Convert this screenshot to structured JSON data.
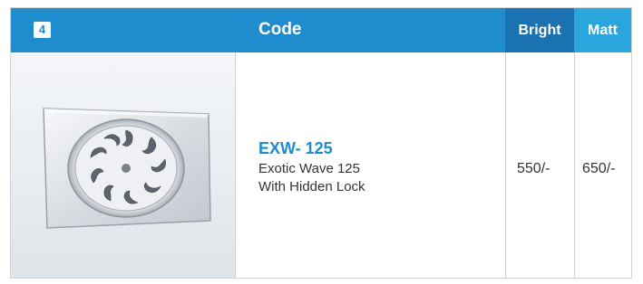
{
  "header": {
    "number": "4",
    "code": "Code",
    "bright": "Bright",
    "matt": "Matt"
  },
  "product": {
    "code": "EXW- 125",
    "name": "Exotic Wave 125",
    "feature": "With Hidden Lock",
    "price_bright": "550/-",
    "price_matt": "650/-",
    "image_icon": "floor-drain-grate"
  },
  "colors": {
    "header_blue": "#1f8ccd",
    "bright_blue": "#1a72b0",
    "matt_blue": "#2ba6dd"
  }
}
